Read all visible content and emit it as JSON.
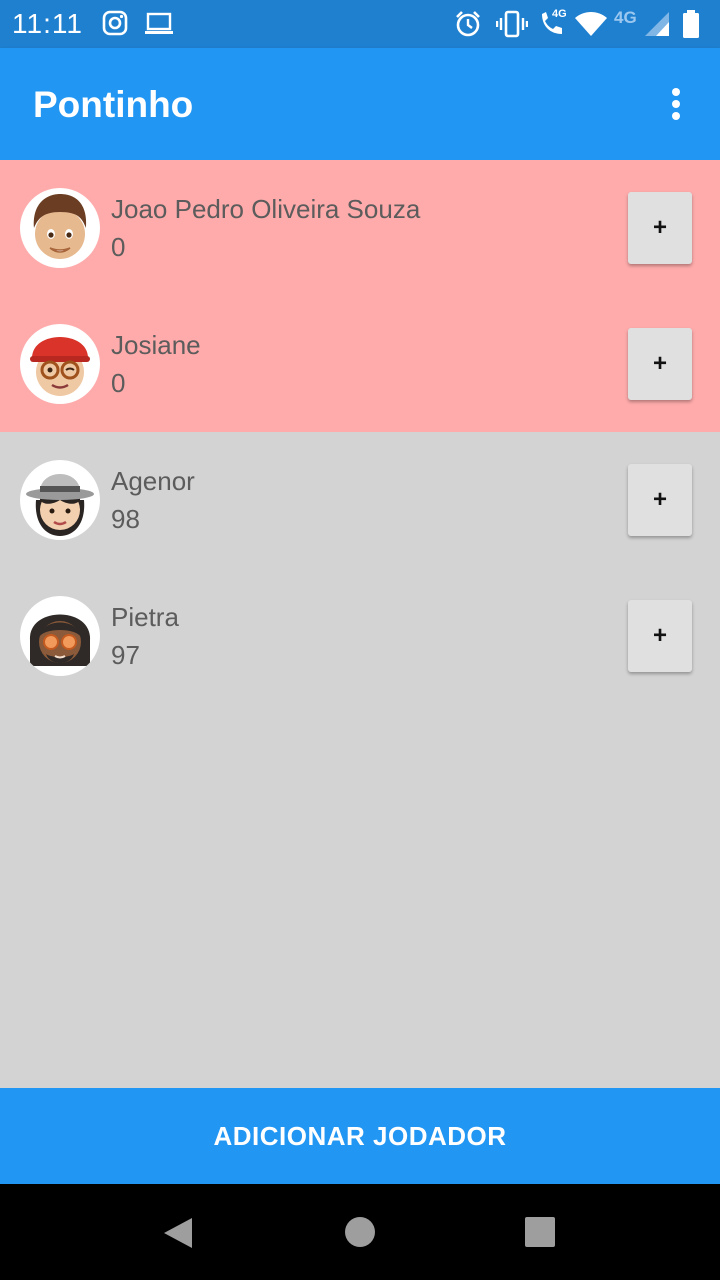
{
  "status_bar": {
    "time": "11:11",
    "network_label": "4G",
    "signal_label": "4G",
    "icons": [
      "instagram-icon",
      "laptop-icon",
      "alarm-icon",
      "vibrate-icon",
      "wifi-call-icon",
      "wifi-icon",
      "signal-icon",
      "battery-icon"
    ]
  },
  "app_bar": {
    "title": "Pontinho",
    "menu_icon": "more-vert-icon"
  },
  "players": [
    {
      "name": "Joao Pedro Oliveira Souza",
      "score": "0",
      "highlighted": true,
      "add_label": "+"
    },
    {
      "name": "Josiane",
      "score": "0",
      "highlighted": true,
      "add_label": "+"
    },
    {
      "name": "Agenor",
      "score": "98",
      "highlighted": false,
      "add_label": "+"
    },
    {
      "name": "Pietra",
      "score": "97",
      "highlighted": false,
      "add_label": "+"
    }
  ],
  "add_player_button": "ADICIONAR JODADOR",
  "nav_bar": {
    "icons": [
      "back-icon",
      "home-icon",
      "recents-icon"
    ]
  },
  "colors": {
    "app_bar": "#2196f3",
    "status_bar": "#1f80d0",
    "highlight_row": "#ffabab",
    "background": "#d3d3d3"
  }
}
